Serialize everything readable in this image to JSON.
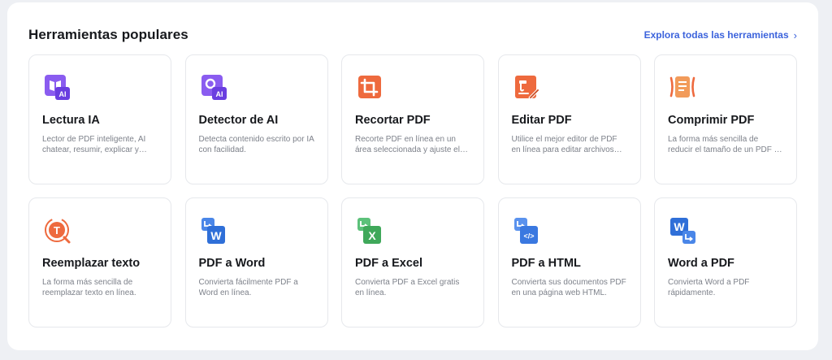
{
  "section": {
    "title": "Herramientas populares",
    "explore_label": "Explora todas las herramientas",
    "explore_chevron": "›"
  },
  "tools": [
    {
      "title": "Lectura IA",
      "desc": "Lector de PDF inteligente, AI chatear, resumir, explicar y…",
      "icon": "ai-reading-icon",
      "icon_text": "AI"
    },
    {
      "title": "Detector de AI",
      "desc": "Detecta contenido escrito por IA con facilidad.",
      "icon": "ai-detector-icon",
      "icon_text": "AI"
    },
    {
      "title": "Recortar PDF",
      "desc": "Recorte PDF en línea en un área seleccionada y ajuste el…",
      "icon": "crop-icon"
    },
    {
      "title": "Editar PDF",
      "desc": "Utilice el mejor editor de PDF en línea para editar archivos…",
      "icon": "edit-pdf-icon"
    },
    {
      "title": "Comprimir PDF",
      "desc": "La forma más sencilla de reducir el tamaño de un PDF …",
      "icon": "compress-icon"
    },
    {
      "title": "Reemplazar texto",
      "desc": "La forma más sencilla de reemplazar texto en línea.",
      "icon": "replace-text-icon",
      "icon_text": "T"
    },
    {
      "title": "PDF a Word",
      "desc": "Convierta fácilmente PDF a Word en línea.",
      "icon": "pdf-to-word-icon",
      "icon_text": "W"
    },
    {
      "title": "PDF a Excel",
      "desc": "Convierta PDF a Excel gratis en línea.",
      "icon": "pdf-to-excel-icon",
      "icon_text": "X"
    },
    {
      "title": "PDF a HTML",
      "desc": "Convierta sus documentos PDF en una página web HTML.",
      "icon": "pdf-to-html-icon",
      "icon_text": "</>"
    },
    {
      "title": "Word a PDF",
      "desc": "Convierta Word a PDF rápidamente.",
      "icon": "word-to-pdf-icon",
      "icon_text": "W"
    }
  ],
  "colors": {
    "accent": "#3c63dc",
    "ai_purple": "#7b4be8",
    "orange": "#e8663c",
    "word_blue": "#2f6fd8",
    "excel_green": "#3fa85a",
    "html_blue": "#3a78e0"
  }
}
